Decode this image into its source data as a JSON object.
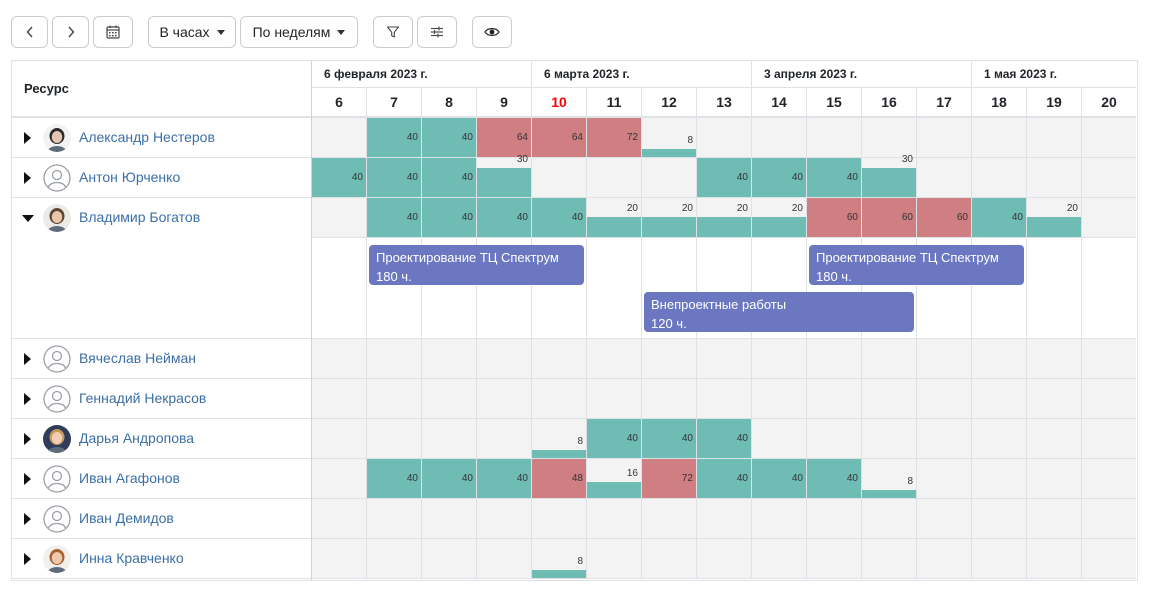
{
  "toolbar": {
    "prev_icon": "chevron-left-icon",
    "next_icon": "chevron-right-icon",
    "calendar_icon": "calendar-icon",
    "units_label": "В часах",
    "period_label": "По неделям",
    "filter_icon": "filter-icon",
    "settings_icon": "sliders-icon",
    "view_icon": "eye-icon"
  },
  "header": {
    "resource_label": "Ресурс",
    "months": [
      "6 февраля 2023 г.",
      "6 марта 2023 г.",
      "3 апреля 2023 г.",
      "1 мая 2023 г."
    ],
    "weeks": [
      "6",
      "7",
      "8",
      "9",
      "10",
      "11",
      "12",
      "13",
      "14",
      "15",
      "16",
      "17",
      "18",
      "19",
      "20"
    ],
    "today_week": "10"
  },
  "colors": {
    "normal": "#6fbcb5",
    "overload": "#cf7e82",
    "task": "#6b78c1",
    "today": "#ff0000",
    "link": "#3b6fa5"
  },
  "resources": [
    {
      "name": "Александр Нестеров",
      "avatar": "photo-man-1",
      "expanded": false,
      "cells": [
        null,
        [
          40,
          "n"
        ],
        [
          40,
          "n"
        ],
        [
          64,
          "o"
        ],
        [
          64,
          "o"
        ],
        [
          72,
          "o"
        ],
        [
          8,
          "n"
        ],
        null,
        null,
        null,
        null,
        null,
        null,
        null,
        null
      ]
    },
    {
      "name": "Антон Юрченко",
      "avatar": "placeholder",
      "expanded": false,
      "cells": [
        [
          40,
          "n"
        ],
        [
          40,
          "n"
        ],
        [
          40,
          "n"
        ],
        [
          30,
          "n"
        ],
        null,
        null,
        null,
        [
          40,
          "n"
        ],
        [
          40,
          "n"
        ],
        [
          40,
          "n"
        ],
        [
          30,
          "n"
        ],
        null,
        null,
        null,
        null
      ]
    },
    {
      "name": "Владимир Богатов",
      "avatar": "photo-man-2",
      "expanded": true,
      "cells": [
        null,
        [
          40,
          "n"
        ],
        [
          40,
          "n"
        ],
        [
          40,
          "n"
        ],
        [
          40,
          "n"
        ],
        [
          20,
          "n"
        ],
        [
          20,
          "n"
        ],
        [
          20,
          "n"
        ],
        [
          20,
          "n"
        ],
        [
          60,
          "o"
        ],
        [
          60,
          "o"
        ],
        [
          60,
          "o"
        ],
        [
          40,
          "n"
        ],
        [
          20,
          "n"
        ],
        null
      ],
      "tasks": [
        {
          "title": "Проектирование ТЦ Спектрум",
          "hours": "180 ч.",
          "start": 1,
          "end": 5,
          "lane": 0
        },
        {
          "title": "Проектирование ТЦ Спектрум",
          "hours": "180 ч.",
          "start": 9,
          "end": 13,
          "lane": 0
        },
        {
          "title": "Внепроектные работы",
          "hours": "120 ч.",
          "start": 6,
          "end": 11,
          "lane": 1
        }
      ]
    },
    {
      "name": "Вячеслав Нейман",
      "avatar": "placeholder",
      "expanded": false,
      "cells": [
        null,
        null,
        null,
        null,
        null,
        null,
        null,
        null,
        null,
        null,
        null,
        null,
        null,
        null,
        null
      ]
    },
    {
      "name": "Геннадий Некрасов",
      "avatar": "placeholder",
      "expanded": false,
      "cells": [
        null,
        null,
        null,
        null,
        null,
        null,
        null,
        null,
        null,
        null,
        null,
        null,
        null,
        null,
        null
      ]
    },
    {
      "name": "Дарья Андропова",
      "avatar": "photo-woman-1",
      "expanded": false,
      "cells": [
        null,
        null,
        null,
        null,
        [
          8,
          "n"
        ],
        [
          40,
          "n"
        ],
        [
          40,
          "n"
        ],
        [
          40,
          "n"
        ],
        null,
        null,
        null,
        null,
        null,
        null,
        null
      ]
    },
    {
      "name": "Иван Агафонов",
      "avatar": "placeholder",
      "expanded": false,
      "cells": [
        null,
        [
          40,
          "n"
        ],
        [
          40,
          "n"
        ],
        [
          40,
          "n"
        ],
        [
          48,
          "o"
        ],
        [
          16,
          "n"
        ],
        [
          72,
          "o"
        ],
        [
          40,
          "n"
        ],
        [
          40,
          "n"
        ],
        [
          40,
          "n"
        ],
        [
          8,
          "n"
        ],
        null,
        null,
        null,
        null
      ]
    },
    {
      "name": "Иван Демидов",
      "avatar": "placeholder",
      "expanded": false,
      "cells": [
        null,
        null,
        null,
        null,
        null,
        null,
        null,
        null,
        null,
        null,
        null,
        null,
        null,
        null,
        null
      ]
    },
    {
      "name": "Инна Кравченко",
      "avatar": "photo-woman-2",
      "expanded": false,
      "cells": [
        null,
        null,
        null,
        null,
        [
          8,
          "n"
        ],
        null,
        null,
        null,
        null,
        null,
        null,
        null,
        null,
        null,
        null
      ]
    }
  ]
}
